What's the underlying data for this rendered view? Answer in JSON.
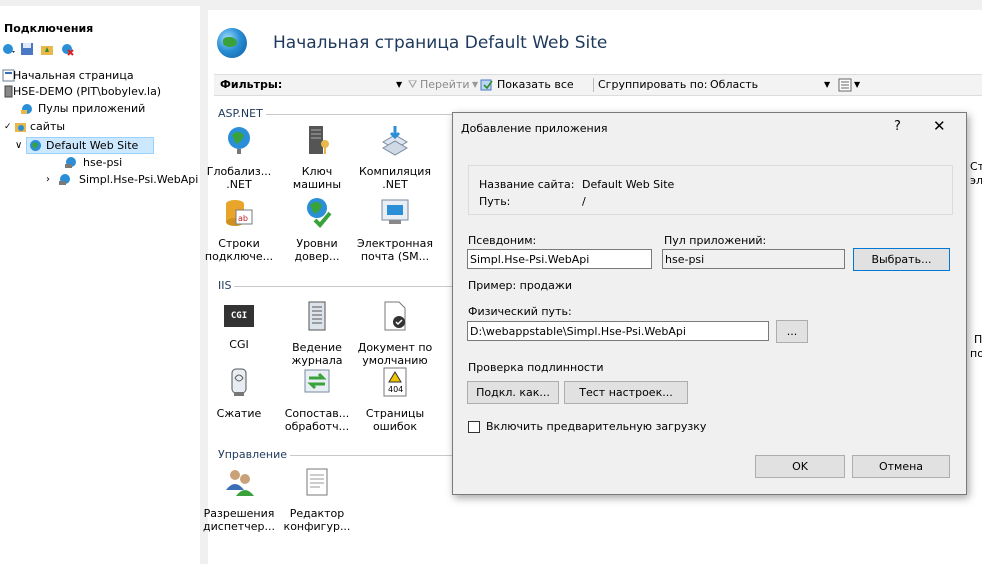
{
  "left_pane": {
    "title": "Подключения",
    "tree": [
      {
        "label": "Начальная страница"
      },
      {
        "label": "HSE-DEMO (PIT\\bobylev.la)"
      },
      {
        "label": "Пулы приложений"
      },
      {
        "label": "сайты"
      },
      {
        "label": "Default Web Site"
      },
      {
        "label": "hse-psi"
      },
      {
        "label": "Simpl.Hse-Psi.WebApi"
      }
    ]
  },
  "main": {
    "title": "Начальная страница Default Web Site",
    "filters_label": "Фильтры:",
    "go_label": "Перейти",
    "show_all_label": "Показать все",
    "group_by_label": "Сгруппировать по:",
    "group_by_value": "Область",
    "groups": {
      "aspnet": "ASP.NET",
      "iis": "IIS",
      "management": "Управление"
    },
    "features": {
      "globalization": [
        "Глобализ...",
        ".NET"
      ],
      "machine_key": [
        "Ключ",
        "машины"
      ],
      "compilation": [
        "Компиляция",
        ".NET"
      ],
      "conn_strings": [
        "Строки",
        "подключе..."
      ],
      "trust_levels": [
        "Уровни",
        "довер..."
      ],
      "smtp": [
        "Электронная",
        "почта (SM..."
      ],
      "cgi": [
        "CGI"
      ],
      "logging": [
        "Ведение",
        "журнала"
      ],
      "default_doc": [
        "Документ по",
        "умолчанию"
      ],
      "compression": [
        "Сжатие"
      ],
      "handler_map": [
        "Сопостав...",
        "обработч..."
      ],
      "error_pages": [
        "Страницы",
        "ошибок"
      ],
      "mgr_perms": [
        "Разрешения",
        "диспетчер..."
      ],
      "config_editor": [
        "Редактор",
        "конфигур..."
      ]
    },
    "cgi_badge": "CGI",
    "err_badge": "404",
    "right_cut": [
      "Ст",
      "эл",
      "П",
      "по"
    ]
  },
  "dialog": {
    "title": "Добавление приложения",
    "help": "?",
    "close": "✕",
    "site_name_label": "Название сайта:",
    "site_name_value": "Default Web Site",
    "path_label": "Путь:",
    "path_value": "/",
    "alias_label": "Псевдоним:",
    "alias_value": "Simpl.Hse-Psi.WebApi",
    "pool_label": "Пул приложений:",
    "pool_value": "hse-psi",
    "select_button": "Выбрать...",
    "example": "Пример: продажи",
    "physical_path_label": "Физический путь:",
    "physical_path_value": "D:\\webappstable\\Simpl.Hse-Psi.WebApi",
    "browse_button": "...",
    "auth_label": "Проверка подлинности",
    "connect_as_button": "Подкл. как...",
    "test_settings_button": "Тест настроек...",
    "preload_label": "Включить предварительную загрузку",
    "ok_button": "OK",
    "cancel_button": "Отмена"
  }
}
